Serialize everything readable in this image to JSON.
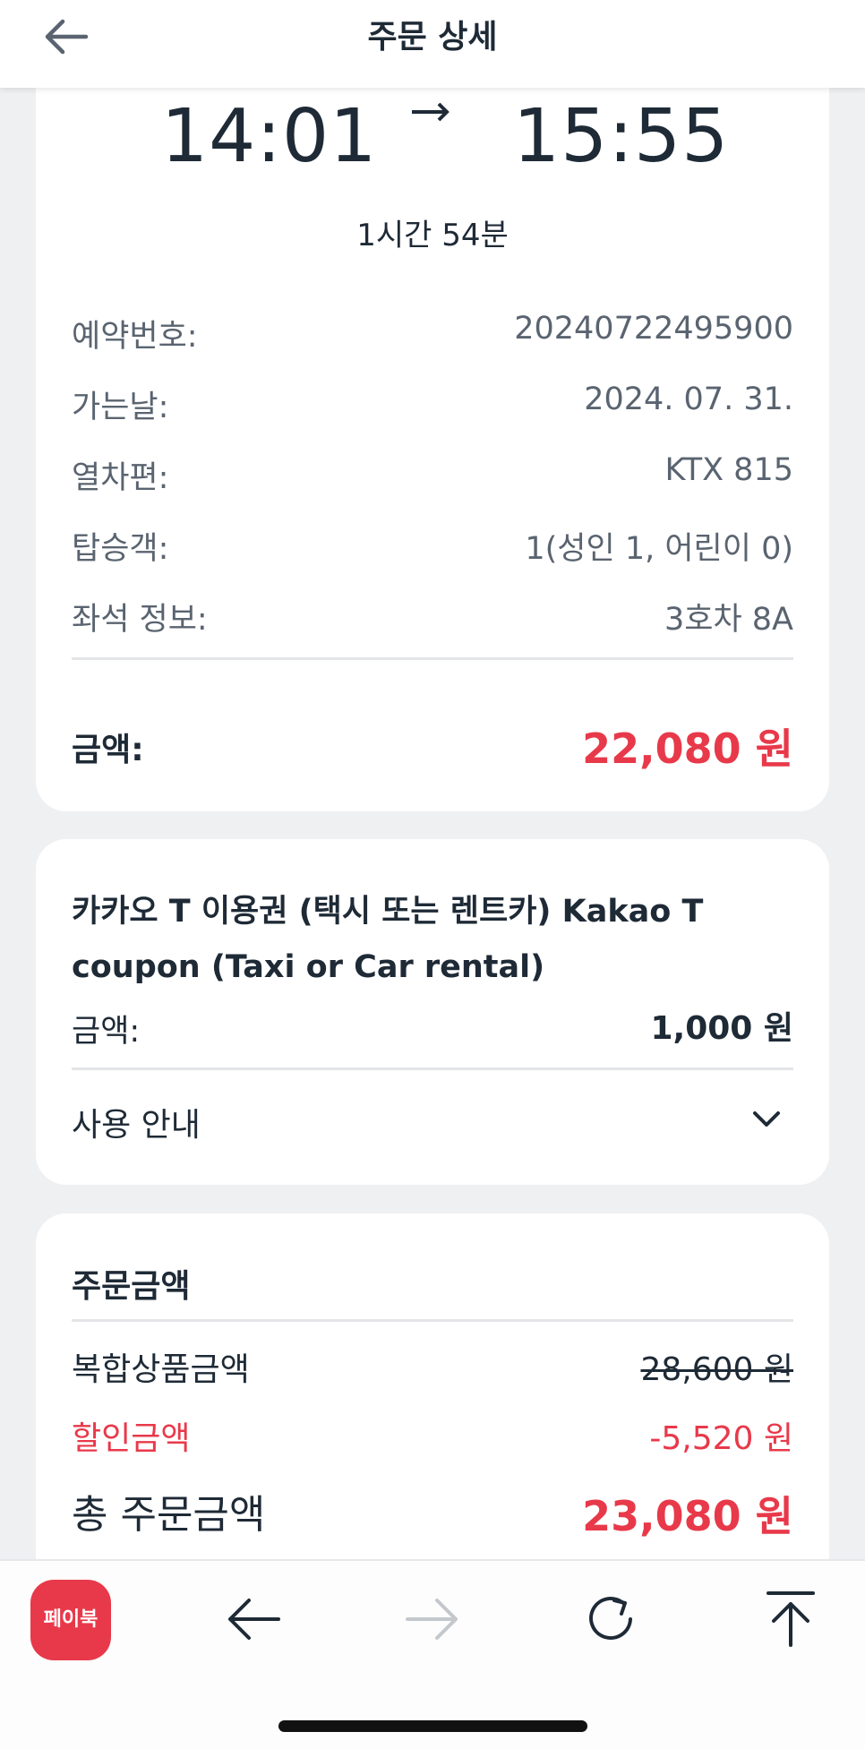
{
  "header": {
    "title": "주문 상세",
    "back_icon": "arrow-left-icon"
  },
  "trip": {
    "departure_time": "14:01",
    "arrival_time": "15:55",
    "duration": "1시간 54분",
    "details": [
      {
        "label": "예약번호:",
        "value": "20240722495900"
      },
      {
        "label": "가는날:",
        "value": "2024. 07. 31."
      },
      {
        "label": "열차편:",
        "value": "KTX 815"
      },
      {
        "label": "탑승객:",
        "value": "1(성인 1, 어린이 0)"
      },
      {
        "label": "좌석 정보:",
        "value": "3호차 8A"
      }
    ],
    "amount_label": "금액:",
    "amount_value": "22,080 원"
  },
  "coupon": {
    "title": "카카오 T 이용권 (택시 또는 렌트카) Kakao T coupon (Taxi or Car rental)",
    "amount_label": "금액:",
    "amount_value": "1,000 원",
    "usage_label": "사용 안내"
  },
  "order": {
    "title": "주문금액",
    "product_label": "복합상품금액",
    "product_value": "28,600 원",
    "discount_label": "할인금액",
    "discount_value": "-5,520 원",
    "total_label": "총 주문금액",
    "total_value": "23,080 원"
  },
  "bottom_bar": {
    "paybook_label": "페이북",
    "icons": [
      "arrow-left-icon",
      "arrow-right-icon",
      "reload-icon",
      "scroll-top-icon"
    ]
  },
  "colors": {
    "accent": "#e8394a",
    "text": "#1e2a36",
    "muted": "#5a6470",
    "background": "#eff0f2"
  }
}
